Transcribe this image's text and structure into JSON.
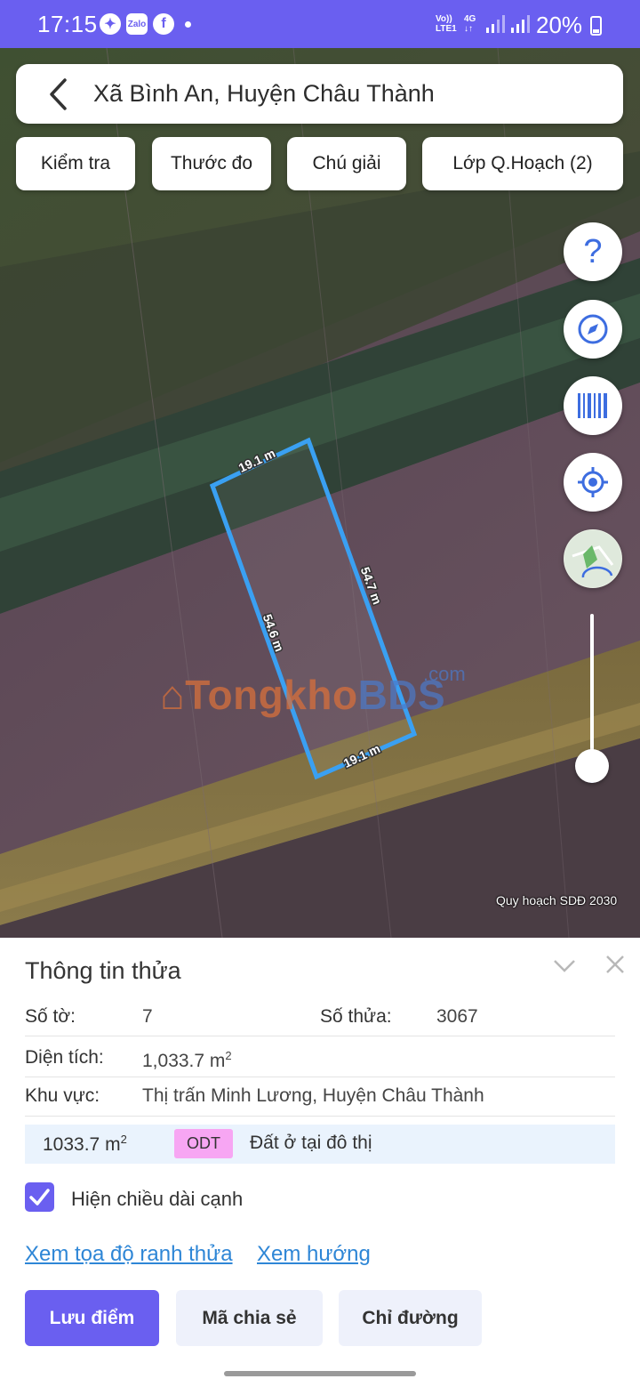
{
  "status_bar": {
    "time": "17:15",
    "app_icons": [
      "Zalo",
      "f"
    ],
    "network_top": "Vo))",
    "network_bottom": "LTE1",
    "network_type": "4G",
    "battery": "20%"
  },
  "search": {
    "title": "Xã Bình An, Huyện Châu Thành"
  },
  "chips": [
    "Kiểm tra",
    "Thước đo",
    "Chú giải",
    "Lớp Q.Hoạch (2)"
  ],
  "map_controls": {
    "help_label": "?",
    "icons": [
      "help-icon",
      "compass-icon",
      "barcode-icon",
      "my-location-icon",
      "map-layer-icon"
    ],
    "zoom_level": 0.1
  },
  "parcel": {
    "edges": [
      "19.1 m",
      "54.7 m",
      "19.1 m",
      "54.6 m"
    ]
  },
  "watermark": {
    "part1": "Tongkho",
    "part2": "BDS",
    "suffix": ".com"
  },
  "map_credit": "Quy hoạch SDĐ 2030",
  "info": {
    "title": "Thông tin thửa",
    "so_to_label": "Số tờ:",
    "so_to_value": "7",
    "so_thua_label": "Số thửa:",
    "so_thua_value": "3067",
    "dien_tich_label": "Diện tích:",
    "dien_tich_value": "1,033.7 m",
    "dien_tich_unit_sup": "2",
    "khu_vuc_label": "Khu vực:",
    "khu_vuc_value": "Thị trấn Minh Lương, Huyện Châu Thành",
    "zone": {
      "area": "1033.7 m",
      "area_sup": "2",
      "code": "ODT",
      "description": "Đất ở tại đô thị",
      "code_color": "#f7a6f3"
    },
    "checkbox_label": "Hiện chiều dài cạnh",
    "checkbox_checked": true,
    "links": [
      "Xem tọa độ ranh thửa",
      "Xem hướng"
    ],
    "buttons": [
      "Lưu điểm",
      "Mã chia sẻ",
      "Chỉ đường"
    ]
  },
  "colors": {
    "accent": "#6a5ff0",
    "link": "#2e86d6",
    "parcel_outline": "#3aa0f2"
  }
}
